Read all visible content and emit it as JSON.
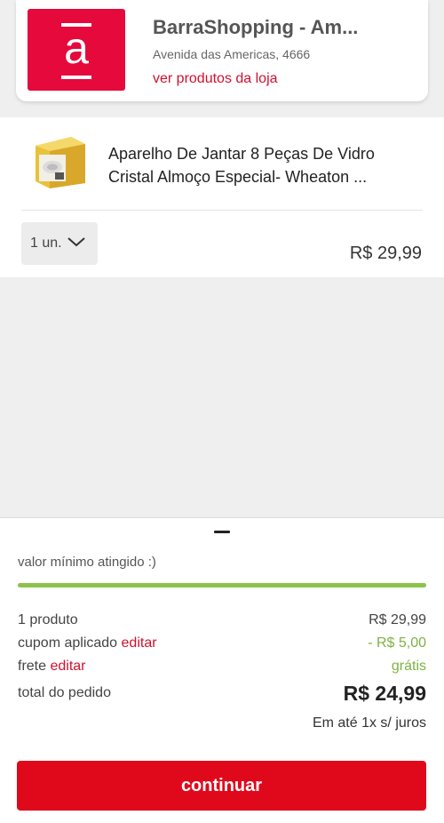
{
  "store": {
    "name": "BarraShopping - Am...",
    "address": "Avenida das Americas, 4666",
    "link": "ver produtos da loja",
    "logo_letter": "a"
  },
  "item": {
    "title": "Aparelho De Jantar 8 Peças De Vidro Cristal Almoço Especial- Wheaton ...",
    "quantity": "1 un.",
    "price": "R$ 29,99"
  },
  "summary": {
    "min_message": "valor mínimo atingido :)",
    "progress_percent": 100,
    "products_label": "1 produto",
    "products_value": "R$ 29,99",
    "coupon_label": "cupom aplicado",
    "coupon_edit": "editar",
    "coupon_value": "- R$ 5,00",
    "shipping_label": "frete",
    "shipping_edit": "editar",
    "shipping_value": "grátis",
    "total_label": "total do pedido",
    "total_value": "R$ 24,99",
    "installments": "Em até 1x s/ juros"
  },
  "cta": {
    "label": "continuar"
  },
  "colors": {
    "brand_red": "#e5093c",
    "accent_red": "#d0102f",
    "green": "#8bc34a"
  }
}
